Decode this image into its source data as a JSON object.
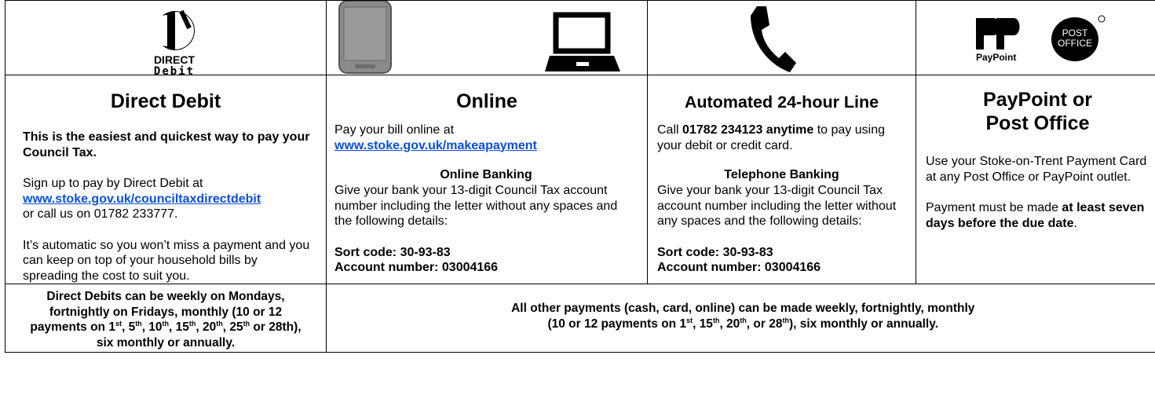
{
  "icons": {
    "dd_logo_line1": "DIRECT",
    "dd_logo_line2": "Debit",
    "paypoint_label": "PayPoint",
    "postoffice_line1": "POST",
    "postoffice_line2": "OFFICE"
  },
  "direct_debit": {
    "heading": "Direct Debit",
    "intro": "This is the easiest and quickest way to pay your Council Tax.",
    "signup_text": "Sign up to pay by Direct Debit at",
    "signup_link": "www.stoke.gov.uk/counciltaxdirectdebit",
    "call_text": "or call us on 01782 233777.",
    "auto_text": "It’s automatic so you won’t miss a payment and you can keep on top of your household bills by spreading the cost to suit you."
  },
  "online": {
    "heading": "Online",
    "pay_text": "Pay your bill online at",
    "pay_link": "www.stoke.gov.uk/makeapayment",
    "banking_heading": "Online Banking",
    "banking_text": "Give your bank your 13-digit Council Tax account number including the letter without any spaces and the following details:",
    "sort_code": "Sort code: 30-93-83",
    "account_number": "Account number: 03004166"
  },
  "automated": {
    "heading": "Automated 24-hour Line",
    "call_prefix": "Call ",
    "call_bold": "01782 234123 anytime",
    "call_suffix": " to pay using your debit or credit card.",
    "banking_heading": "Telephone Banking",
    "banking_text": "Give your bank your 13-digit Council Tax account number including the letter without any spaces and the following details:",
    "sort_code": "Sort code: 30-93-83",
    "account_number": "Account number: 03004166"
  },
  "paypoint": {
    "heading_line1": "PayPoint or",
    "heading_line2": "Post Office",
    "card_text": "Use your Stoke-on-Trent Payment Card at any Post Office or PayPoint outlet.",
    "payment_prefix": "Payment must be made ",
    "payment_bold": "at least seven days before the due date",
    "payment_suffix": "."
  },
  "footer": {
    "dd_a": "Direct Debits can be weekly on Mondays, fortnightly on Fridays, monthly (10 or 12 payments on 1",
    "dd_st": "st",
    "dd_b": ", 5",
    "dd_th1": "th",
    "dd_c": ", 10",
    "dd_th2": "th",
    "dd_d": ", 15",
    "dd_th3": "th",
    "dd_e": ", 20",
    "dd_th4": "th",
    "dd_f": ", 25",
    "dd_th5": "th",
    "dd_g": " or 28th), six monthly or annually.",
    "other_line1": "All other payments (cash, card, online) can be made weekly, fortnightly, monthly",
    "other_a": "(10 or 12 payments on 1",
    "other_st": "st",
    "other_b": ", 15",
    "other_th1": "th",
    "other_c": ", 20",
    "other_th2": "th",
    "other_d": ", or 28",
    "other_th3": "th",
    "other_e": "), six monthly or annually."
  },
  "colors": {
    "link": "#0b4fd6"
  }
}
